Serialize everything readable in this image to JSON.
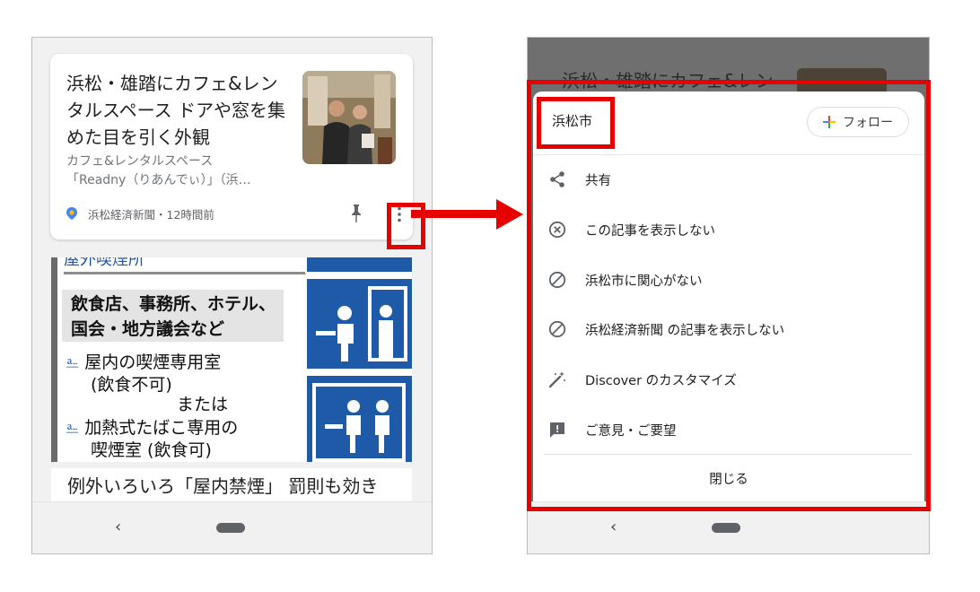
{
  "left_screen": {
    "article_card": {
      "title": "浜松・雄踏にカフェ&レンタルスペース ドアや窓を集めた目を引く外観",
      "snippet_line1": "カフェ&レンタルスペース",
      "snippet_line2": "「Readny（りあんでぃ）」（浜…",
      "source": "浜松経済新聞・12時間前"
    },
    "poster": {
      "top_text": "屋外喫煙所",
      "heading_line1": "飲食店、事務所、ホテル、",
      "heading_line2": "国会・地方議会など",
      "line1": "屋内の喫煙専用室",
      "line2": "(飲食不可)",
      "line3": "または",
      "line4": "加熱式たばこ専用の",
      "line5": "喫煙室 (飲食可)"
    },
    "next_title": "例外いろいろ「屋内禁煙」 罰則も効き",
    "nav": {
      "back": "‹"
    }
  },
  "right_screen": {
    "dimmed_title": "浜松・雄踏にカフェ&レン",
    "sheet": {
      "topic": "浜松市",
      "follow_label": "フォロー",
      "items": [
        {
          "label": "共有",
          "icon": "share-icon"
        },
        {
          "label": "この記事を表示しない",
          "icon": "cancel-circle-icon"
        },
        {
          "label": "浜松市に関心がない",
          "icon": "block-icon"
        },
        {
          "label": "浜松経済新聞 の記事を表示しない",
          "icon": "block-icon"
        },
        {
          "label": "Discover のカスタマイズ",
          "icon": "magic-wand-icon"
        },
        {
          "label": "ご意見・ご要望",
          "icon": "feedback-icon"
        }
      ],
      "close_label": "閉じる"
    },
    "nav": {
      "back": "‹"
    }
  },
  "colors": {
    "highlight": "#e60000",
    "poster_blue": "#1e5aa8"
  }
}
